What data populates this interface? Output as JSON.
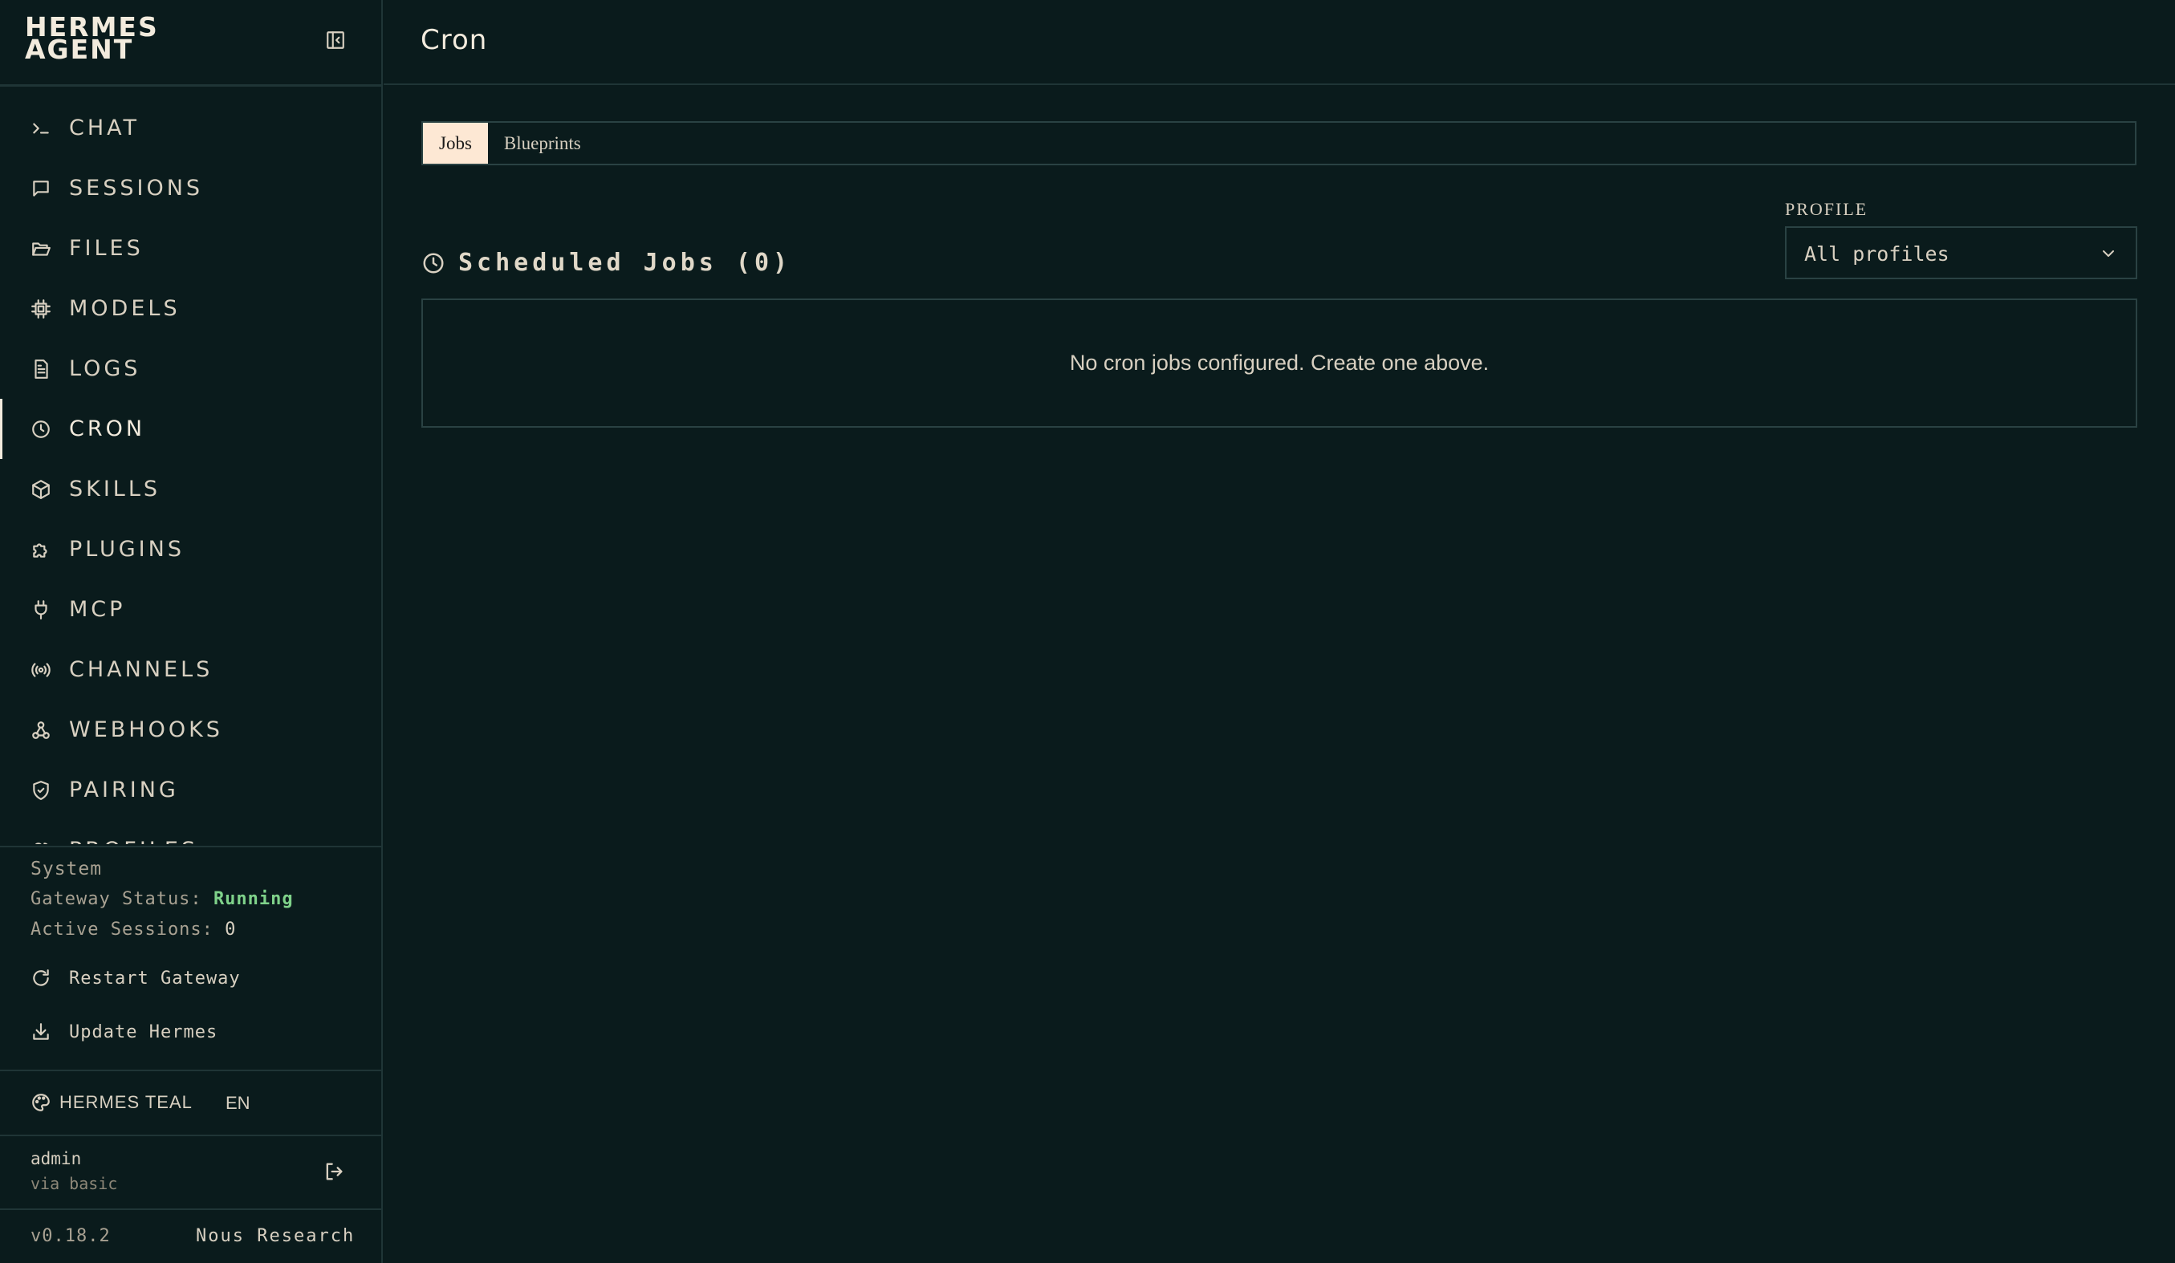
{
  "brand": {
    "name": "HERMES AGENT"
  },
  "nav": {
    "items": [
      {
        "label": "CHAT",
        "icon": "terminal-icon"
      },
      {
        "label": "SESSIONS",
        "icon": "message-square-icon"
      },
      {
        "label": "FILES",
        "icon": "folder-open-icon"
      },
      {
        "label": "MODELS",
        "icon": "cpu-icon"
      },
      {
        "label": "LOGS",
        "icon": "file-text-icon"
      },
      {
        "label": "CRON",
        "icon": "clock-icon",
        "active": true
      },
      {
        "label": "SKILLS",
        "icon": "package-icon"
      },
      {
        "label": "PLUGINS",
        "icon": "puzzle-icon"
      },
      {
        "label": "MCP",
        "icon": "plug-icon"
      },
      {
        "label": "CHANNELS",
        "icon": "radio-icon"
      },
      {
        "label": "WEBHOOKS",
        "icon": "webhook-icon"
      },
      {
        "label": "PAIRING",
        "icon": "shield-check-icon"
      },
      {
        "label": "PROFILES",
        "icon": "users-icon"
      }
    ]
  },
  "system": {
    "title": "System",
    "gateway_label": "Gateway Status:",
    "gateway_value": "Running",
    "gateway_color": "#7fd28a",
    "sessions_label": "Active Sessions:",
    "sessions_value": "0",
    "restart_label": "Restart Gateway",
    "update_label": "Update Hermes"
  },
  "theme": {
    "label": "HERMES TEAL",
    "language": "EN"
  },
  "user": {
    "name": "admin",
    "auth": "via basic"
  },
  "footer": {
    "version": "v0.18.2",
    "vendor": "Nous Research"
  },
  "page": {
    "title": "Cron"
  },
  "tabs": [
    {
      "label": "Jobs",
      "active": true
    },
    {
      "label": "Blueprints",
      "active": false
    }
  ],
  "jobs": {
    "heading": "Scheduled Jobs (0)",
    "empty_message": "No cron jobs configured. Create one above."
  },
  "profile": {
    "label": "PROFILE",
    "selected": "All profiles"
  },
  "colors": {
    "background": "#0a1b1c",
    "border": "#1f3536",
    "active_tab": "#fde8d4",
    "text": "#e9e2d3"
  }
}
